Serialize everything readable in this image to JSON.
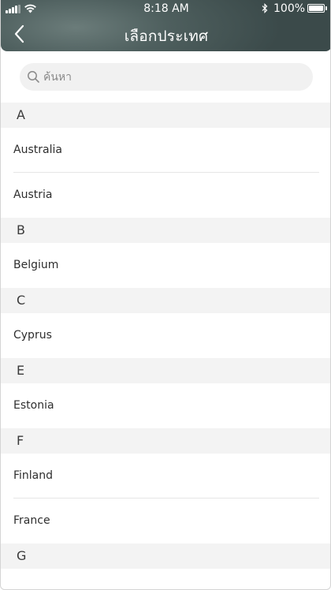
{
  "status_bar": {
    "time": "8:18 AM",
    "battery": "100%",
    "battery_level": 1.0
  },
  "header": {
    "title": "เลือกประเทศ",
    "back_icon": "chevron-left-icon"
  },
  "search": {
    "placeholder": "ค้นหา",
    "value": "",
    "icon": "search-icon"
  },
  "sections": [
    {
      "letter": "A",
      "countries": [
        "Australia",
        "Austria"
      ]
    },
    {
      "letter": "B",
      "countries": [
        "Belgium"
      ]
    },
    {
      "letter": "C",
      "countries": [
        "Cyprus"
      ]
    },
    {
      "letter": "E",
      "countries": [
        "Estonia"
      ]
    },
    {
      "letter": "F",
      "countries": [
        "Finland",
        "France"
      ]
    },
    {
      "letter": "G",
      "countries": []
    }
  ],
  "colors": {
    "header_bg": "#4e5f5e",
    "section_bg": "#f3f3f3",
    "search_bg": "#f1f1f1"
  }
}
